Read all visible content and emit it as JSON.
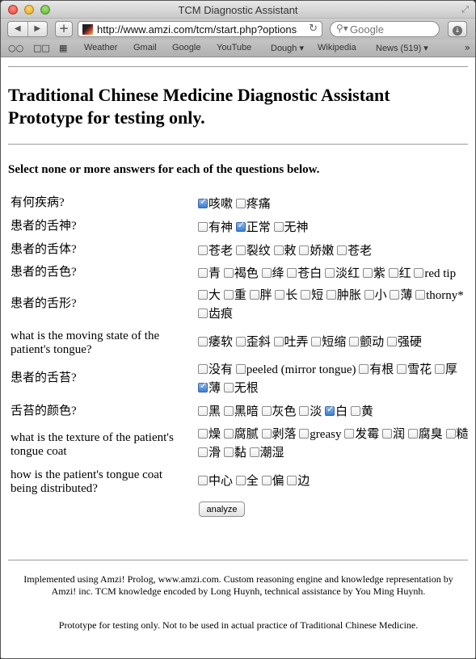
{
  "window": {
    "title": "TCM Diagnostic Assistant"
  },
  "toolbar": {
    "url": "http://www.amzi.com/tcm/start.php?options",
    "search_placeholder": "Google"
  },
  "bookmarks": [
    "Weather",
    "Gmail",
    "Google",
    "YouTube",
    "Dough ▾",
    "Wikipedia",
    "News (519) ▾"
  ],
  "page": {
    "title_line1": "Traditional Chinese Medicine Diagnostic Assistant",
    "title_line2": "Prototype for testing only.",
    "instructions": "Select none or more answers for each of the questions below.",
    "questions": [
      {
        "label": "有何疾病?",
        "options": [
          {
            "label": "咳嗽",
            "checked": true
          },
          {
            "label": "疼痛",
            "checked": false
          }
        ]
      },
      {
        "label": "患者的舌神?",
        "options": [
          {
            "label": "有神",
            "checked": false
          },
          {
            "label": "正常",
            "checked": true
          },
          {
            "label": "无神",
            "checked": false
          }
        ]
      },
      {
        "label": "患者的舌体?",
        "options": [
          {
            "label": "苍老",
            "checked": false
          },
          {
            "label": "裂纹",
            "checked": false
          },
          {
            "label": "敕",
            "checked": false
          },
          {
            "label": "娇嫩",
            "checked": false
          },
          {
            "label": "苍老",
            "checked": false
          }
        ]
      },
      {
        "label": "患者的舌色?",
        "options": [
          {
            "label": "青",
            "checked": false
          },
          {
            "label": "褐色",
            "checked": false
          },
          {
            "label": "绛",
            "checked": false
          },
          {
            "label": "苍白",
            "checked": false
          },
          {
            "label": "淡红",
            "checked": false
          },
          {
            "label": "紫",
            "checked": false
          },
          {
            "label": "红",
            "checked": false
          },
          {
            "label": "red tip",
            "checked": false
          }
        ]
      },
      {
        "label": "患者的舌形?",
        "options": [
          {
            "label": "大",
            "checked": false
          },
          {
            "label": "重",
            "checked": false
          },
          {
            "label": "胖",
            "checked": false
          },
          {
            "label": "长",
            "checked": false
          },
          {
            "label": "短",
            "checked": false
          },
          {
            "label": "肿胀",
            "checked": false
          },
          {
            "label": "小",
            "checked": false
          },
          {
            "label": "薄",
            "checked": false
          },
          {
            "label": "thorny*",
            "checked": false
          },
          {
            "label": "齿痕",
            "checked": false
          }
        ]
      },
      {
        "label": "what is the moving state of the patient's tongue?",
        "options": [
          {
            "label": "痿软",
            "checked": false
          },
          {
            "label": "歪斜",
            "checked": false
          },
          {
            "label": "吐弄",
            "checked": false
          },
          {
            "label": "短缩",
            "checked": false
          },
          {
            "label": "颤动",
            "checked": false
          },
          {
            "label": "强硬",
            "checked": false
          }
        ]
      },
      {
        "label": "患者的舌苔?",
        "options": [
          {
            "label": "没有",
            "checked": false
          },
          {
            "label": "peeled (mirror tongue)",
            "checked": false
          },
          {
            "label": "有根",
            "checked": false
          },
          {
            "label": "雪花",
            "checked": false
          },
          {
            "label": "厚",
            "checked": false
          },
          {
            "label": "薄",
            "checked": true
          },
          {
            "label": "无根",
            "checked": false
          }
        ]
      },
      {
        "label": "舌苔的颜色?",
        "options": [
          {
            "label": "黑",
            "checked": false
          },
          {
            "label": "黑暗",
            "checked": false
          },
          {
            "label": "灰色",
            "checked": false
          },
          {
            "label": "淡",
            "checked": false
          },
          {
            "label": "白",
            "checked": true
          },
          {
            "label": "黄",
            "checked": false
          }
        ]
      },
      {
        "label": "what is the texture of the patient's tongue coat",
        "options": [
          {
            "label": "燥",
            "checked": false
          },
          {
            "label": "腐腻",
            "checked": false
          },
          {
            "label": "剥落",
            "checked": false
          },
          {
            "label": "greasy",
            "checked": false
          },
          {
            "label": "发霉",
            "checked": false
          },
          {
            "label": "润",
            "checked": false
          },
          {
            "label": "腐臭",
            "checked": false
          },
          {
            "label": "糙",
            "checked": false
          },
          {
            "label": "滑",
            "checked": false
          },
          {
            "label": "黏",
            "checked": false
          },
          {
            "label": "潮湿",
            "checked": false
          }
        ]
      },
      {
        "label": "how is the patient's tongue coat being distributed?",
        "options": [
          {
            "label": "中心",
            "checked": false
          },
          {
            "label": "全",
            "checked": false
          },
          {
            "label": "偏",
            "checked": false
          },
          {
            "label": "边",
            "checked": false
          }
        ]
      }
    ],
    "analyze_label": "analyze",
    "footer_line1": "Implemented using Amzi! Prolog, www.amzi.com. Custom reasoning engine and knowledge representation by Amzi! inc. TCM knowledge encoded by Long Huynh, technical assistance by You Ming Huynh.",
    "footer_line2": "Prototype for testing only. Not to be used in actual practice of Traditional Chinese Medicine."
  }
}
